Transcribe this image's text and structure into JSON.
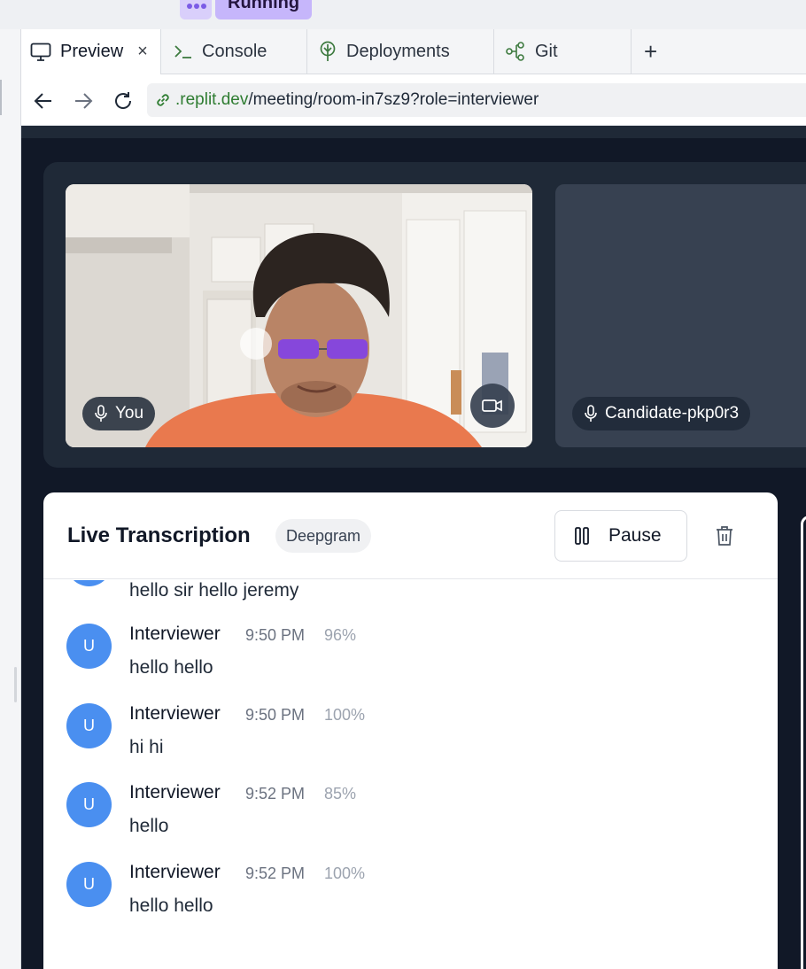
{
  "status": {
    "label": "Running"
  },
  "tabs": [
    {
      "label": "Preview",
      "icon": "monitor-icon",
      "active": true
    },
    {
      "label": "Console",
      "icon": "terminal-icon"
    },
    {
      "label": "Deployments",
      "icon": "deployments-icon"
    },
    {
      "label": "Git",
      "icon": "git-icon"
    }
  ],
  "url": {
    "host": ".replit.dev",
    "path": "/meeting/room-in7sz9?role=interviewer"
  },
  "video": {
    "self_name": "You",
    "remote_name": "Candidate-pkp0r3"
  },
  "transcription": {
    "title": "Live Transcription",
    "provider": "Deepgram",
    "pause_label": "Pause",
    "partial": {
      "text": "hello sir hello jeremy"
    },
    "messages": [
      {
        "initial": "U",
        "speaker": "Interviewer",
        "time": "9:50 PM",
        "confidence": "96%",
        "text": "hello hello"
      },
      {
        "initial": "U",
        "speaker": "Interviewer",
        "time": "9:50 PM",
        "confidence": "100%",
        "text": "hi hi"
      },
      {
        "initial": "U",
        "speaker": "Interviewer",
        "time": "9:52 PM",
        "confidence": "85%",
        "text": "hello"
      },
      {
        "initial": "U",
        "speaker": "Interviewer",
        "time": "9:52 PM",
        "confidence": "100%",
        "text": "hello hello"
      }
    ]
  },
  "colors": {
    "accent": "#4a8ff0",
    "url_host": "#2f7d32",
    "app_bg": "#111827",
    "panel_bg": "#1f2937",
    "running_badge": "#c6b6fb"
  }
}
